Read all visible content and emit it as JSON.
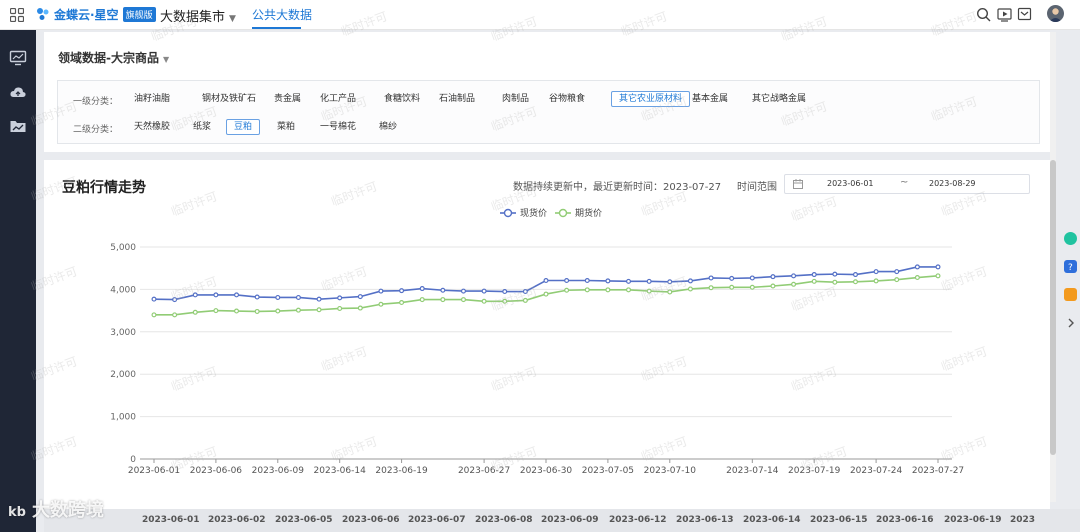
{
  "app": {
    "logo_text": "金蝶云·星空",
    "logo_badge": "旗舰版",
    "nav_market": "大数据集市",
    "nav_public": "公共大数据"
  },
  "domain": {
    "title": "领域数据-大宗商品",
    "level1_label": "一级分类：",
    "level1_items": [
      "油籽油脂",
      "钢材及铁矿石",
      "贵金属",
      "化工产品",
      "食糖饮料",
      "石油制品",
      "肉制品",
      "谷物粮食",
      "其它农业原材料",
      "基本金属",
      "其它战略金属"
    ],
    "level1_active": "其它农业原材料",
    "level2_label": "二级分类：",
    "level2_items": [
      "天然橡胶",
      "纸浆",
      "豆粕",
      "菜粕",
      "一号棉花",
      "棉纱"
    ],
    "level2_active": "豆粕"
  },
  "chart_header": {
    "title": "豆粕行情走势",
    "update_text": "数据持续更新中，最近更新时间：2023-07-27",
    "range_label": "时间范围",
    "range_start": "2023-06-01",
    "range_end": "2023-08-29",
    "range_sep": "~"
  },
  "chart_data": {
    "type": "line",
    "title": "",
    "xlabel": "",
    "ylabel": "",
    "ylim": [
      0,
      5000
    ],
    "yticks": [
      0,
      1000,
      2000,
      3000,
      4000,
      5000
    ],
    "ytick_labels": [
      "0",
      "1,000",
      "2,000",
      "3,000",
      "4,000",
      "5,000"
    ],
    "grid": true,
    "legend_position": "top-center",
    "x": [
      "2023-06-01",
      "2023-06-02",
      "2023-06-05",
      "2023-06-06",
      "2023-06-07",
      "2023-06-08",
      "2023-06-09",
      "2023-06-12",
      "2023-06-13",
      "2023-06-14",
      "2023-06-15",
      "2023-06-16",
      "2023-06-19",
      "2023-06-20",
      "2023-06-21",
      "2023-06-26",
      "2023-06-27",
      "2023-06-28",
      "2023-06-29",
      "2023-06-30",
      "2023-07-03",
      "2023-07-04",
      "2023-07-05",
      "2023-07-06",
      "2023-07-07",
      "2023-07-10",
      "2023-07-11",
      "2023-07-12",
      "2023-07-13",
      "2023-07-14",
      "2023-07-17",
      "2023-07-18",
      "2023-07-19",
      "2023-07-20",
      "2023-07-21",
      "2023-07-24",
      "2023-07-25",
      "2023-07-26",
      "2023-07-27"
    ],
    "x_tick_labels": [
      "2023-06-01",
      "2023-06-06",
      "2023-06-09",
      "2023-06-14",
      "2023-06-19",
      "2023-06-27",
      "2023-06-30",
      "2023-07-05",
      "2023-07-10",
      "2023-07-14",
      "2023-07-19",
      "2023-07-24",
      "2023-07-27"
    ],
    "series": [
      {
        "name": "现货价",
        "color": "#5470c6",
        "values": [
          3770,
          3760,
          3870,
          3870,
          3870,
          3820,
          3810,
          3810,
          3770,
          3800,
          3830,
          3960,
          3970,
          4020,
          3980,
          3960,
          3960,
          3950,
          3950,
          4210,
          4210,
          4210,
          4200,
          4190,
          4190,
          4180,
          4200,
          4270,
          4260,
          4270,
          4300,
          4320,
          4350,
          4360,
          4350,
          4420,
          4420,
          4530,
          4530
        ]
      },
      {
        "name": "期货价",
        "color": "#91cc75",
        "values": [
          3400,
          3400,
          3460,
          3500,
          3490,
          3480,
          3490,
          3510,
          3520,
          3550,
          3560,
          3650,
          3690,
          3760,
          3760,
          3760,
          3720,
          3720,
          3740,
          3890,
          3980,
          3990,
          3990,
          3990,
          3960,
          3940,
          4010,
          4040,
          4050,
          4050,
          4080,
          4120,
          4190,
          4170,
          4180,
          4200,
          4230,
          4280,
          4320
        ]
      }
    ]
  },
  "bottom_dates": [
    "2023-06-01",
    "2023-06-02",
    "2023-06-05",
    "2023-06-06",
    "2023-06-07",
    "2023-06-08",
    "2023-06-09",
    "2023-06-12",
    "2023-06-13",
    "2023-06-14",
    "2023-06-15",
    "2023-06-16",
    "2023-06-19",
    "2023"
  ],
  "watermark": "临时许可",
  "corner_watermark": "大数跨境",
  "colors": {
    "accent": "#1e78d5",
    "sidebar": "#1f2636"
  }
}
